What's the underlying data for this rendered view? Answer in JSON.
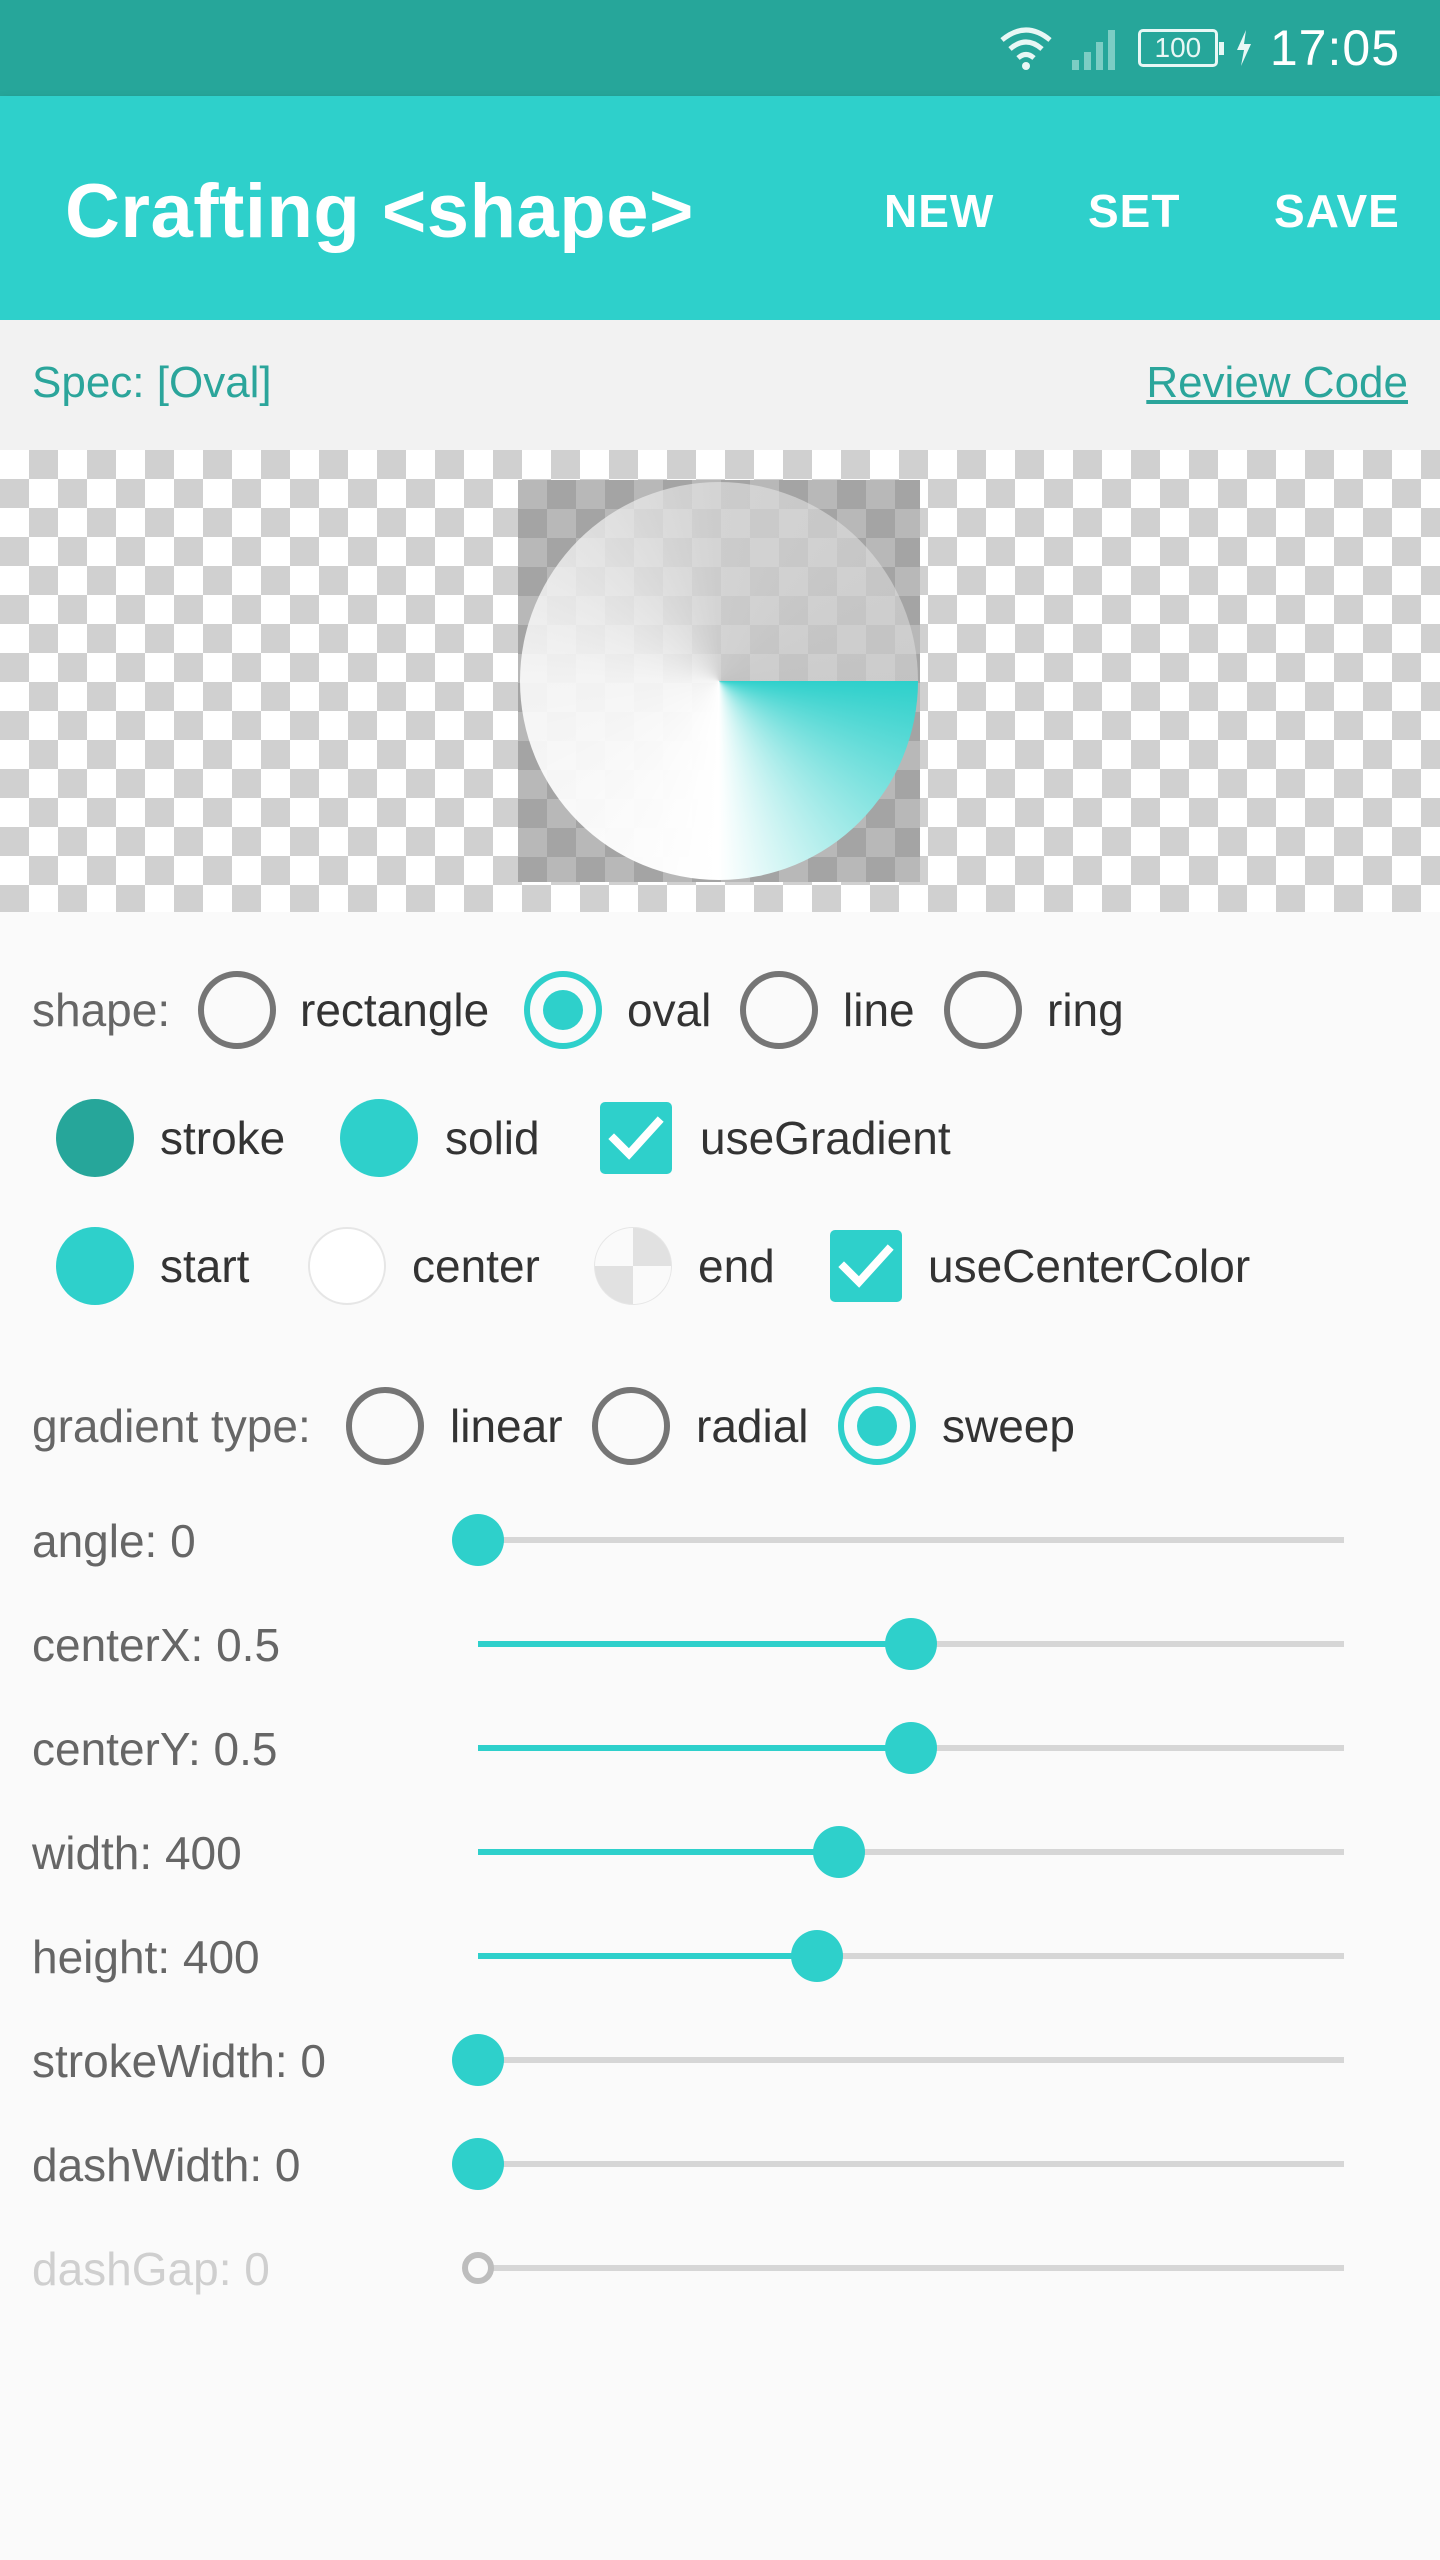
{
  "status_bar": {
    "battery": "100",
    "time": "17:05"
  },
  "app_bar": {
    "title": "Crafting <shape>",
    "actions": [
      "NEW",
      "SET",
      "SAVE"
    ]
  },
  "spec": {
    "label": "Spec: [Oval]",
    "review_link": "Review Code"
  },
  "shape": {
    "label": "shape:",
    "options": [
      {
        "label": "rectangle",
        "selected": false
      },
      {
        "label": "oval",
        "selected": true
      },
      {
        "label": "line",
        "selected": false
      },
      {
        "label": "ring",
        "selected": false
      }
    ]
  },
  "colors": {
    "stroke_label": "stroke",
    "stroke_color": "#26a69a",
    "solid_label": "solid",
    "solid_color": "#2ed0cb",
    "use_gradient_label": "useGradient",
    "use_gradient_checked": true,
    "start_label": "start",
    "start_color": "#2ed0cb",
    "center_label": "center",
    "center_color": "#ffffff",
    "end_label": "end",
    "end_color": "transparent",
    "use_center_color_label": "useCenterColor",
    "use_center_color_checked": true
  },
  "gradient_type": {
    "label": "gradient type:",
    "options": [
      {
        "label": "linear",
        "selected": false
      },
      {
        "label": "radial",
        "selected": false
      },
      {
        "label": "sweep",
        "selected": true
      }
    ]
  },
  "sliders": [
    {
      "label": "angle: 0",
      "fraction": 0.0,
      "enabled": true
    },
    {
      "label": "centerX: 0.5",
      "fraction": 0.5,
      "enabled": true
    },
    {
      "label": "centerY: 0.5",
      "fraction": 0.5,
      "enabled": true
    },
    {
      "label": "width: 400",
      "fraction": 0.417,
      "enabled": true
    },
    {
      "label": "height: 400",
      "fraction": 0.392,
      "enabled": true
    },
    {
      "label": "strokeWidth: 0",
      "fraction": 0.0,
      "enabled": true
    },
    {
      "label": "dashWidth: 0",
      "fraction": 0.0,
      "enabled": true
    },
    {
      "label": "dashGap: 0",
      "fraction": 0.0,
      "enabled": false
    }
  ],
  "accent_color": "#2ed0cb",
  "primary_dark_color": "#26a69a"
}
